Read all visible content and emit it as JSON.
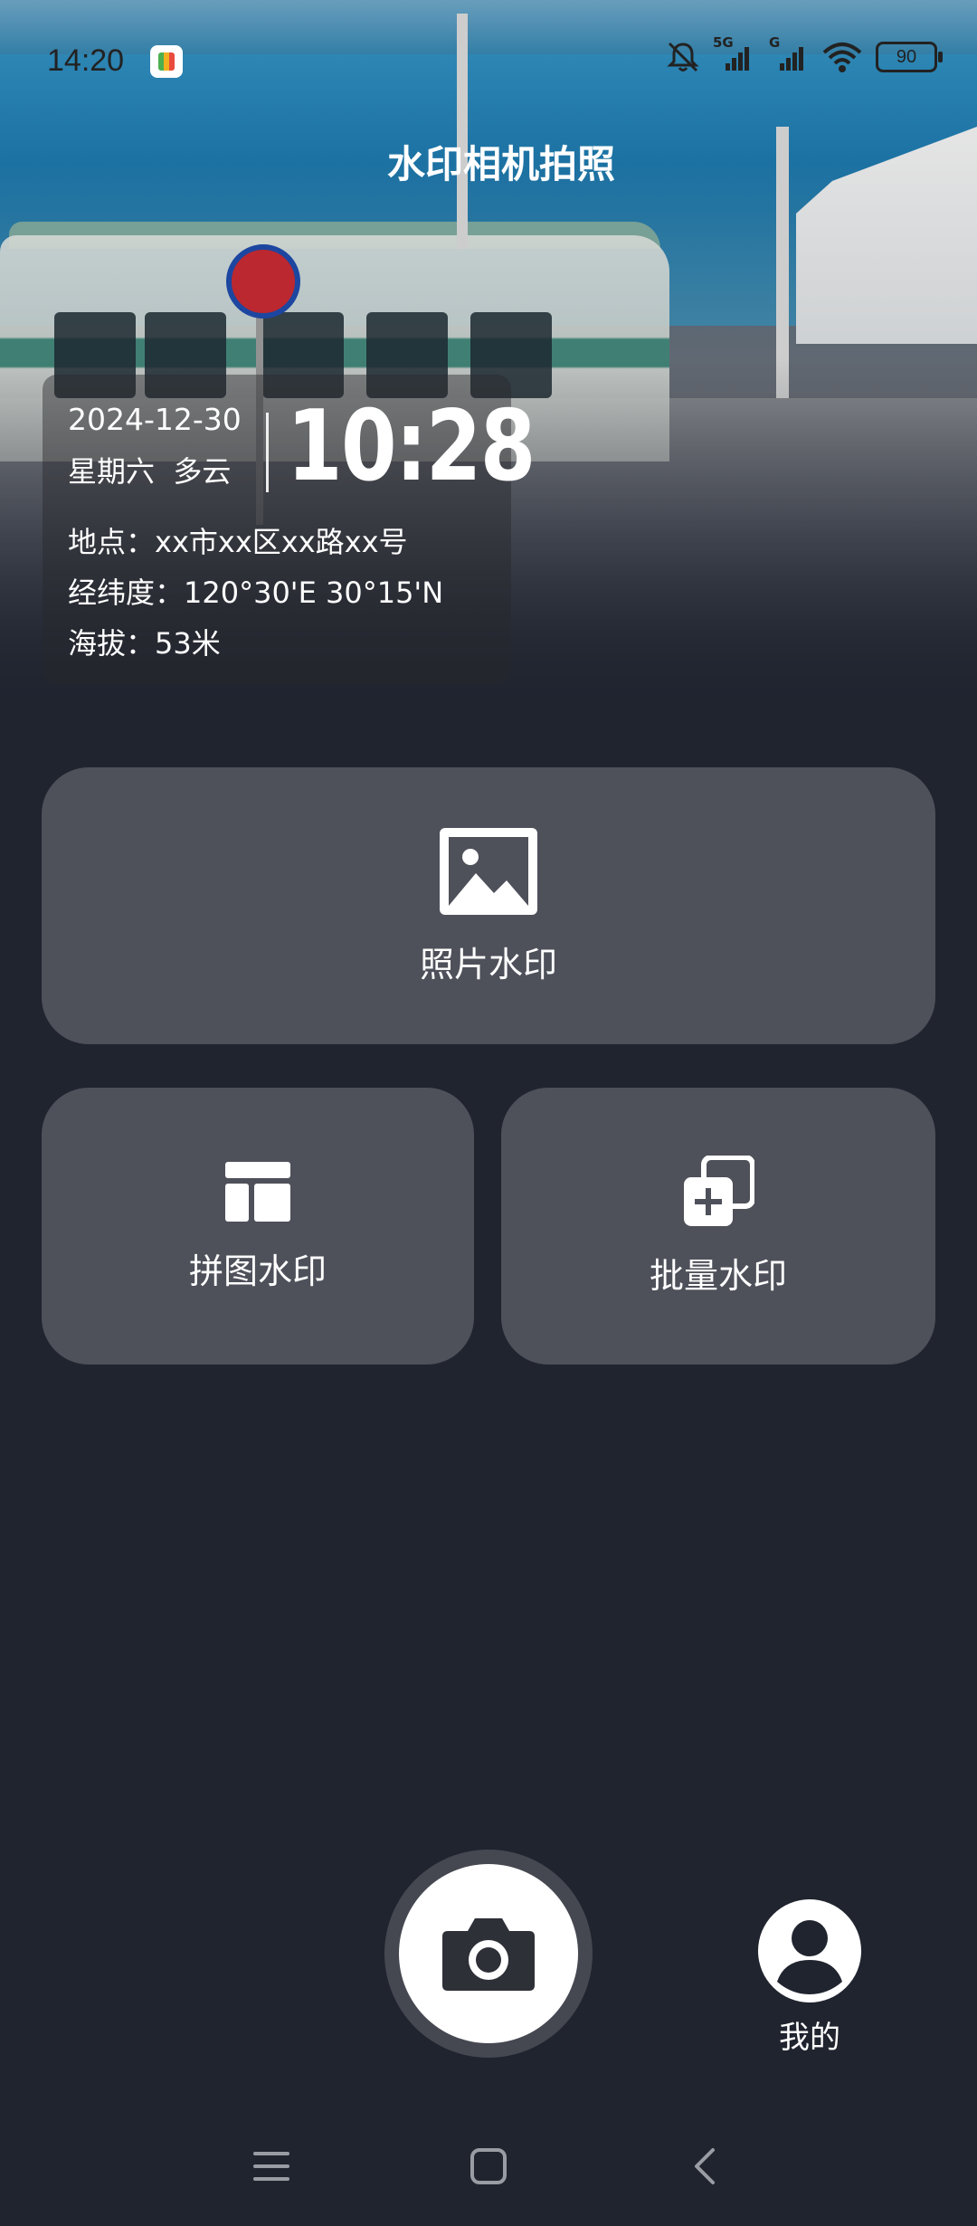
{
  "status_bar": {
    "time": "14:20",
    "network_5g": "5G",
    "network_g": "G",
    "battery": "90",
    "icons": [
      "app-notification-icon",
      "mute-bell-icon",
      "signal-icon",
      "signal-icon",
      "wifi-icon",
      "battery-icon"
    ]
  },
  "header": {
    "title": "水印相机拍照"
  },
  "watermark": {
    "date": "2024-12-30",
    "weekday_weather": "星期六  多云",
    "time": "10:28",
    "location": "地点：xx市xx区xx路xx号",
    "coordinates": "经纬度：120°30'E 30°15'N",
    "altitude": "海拔：53米"
  },
  "actions": {
    "photo_watermark": "照片水印",
    "collage_watermark": "拼图水印",
    "batch_watermark": "批量水印"
  },
  "bottom": {
    "mine_label": "我的"
  },
  "colors": {
    "background": "#20242f",
    "card": "#4e505a",
    "accent": "#ffffff"
  }
}
